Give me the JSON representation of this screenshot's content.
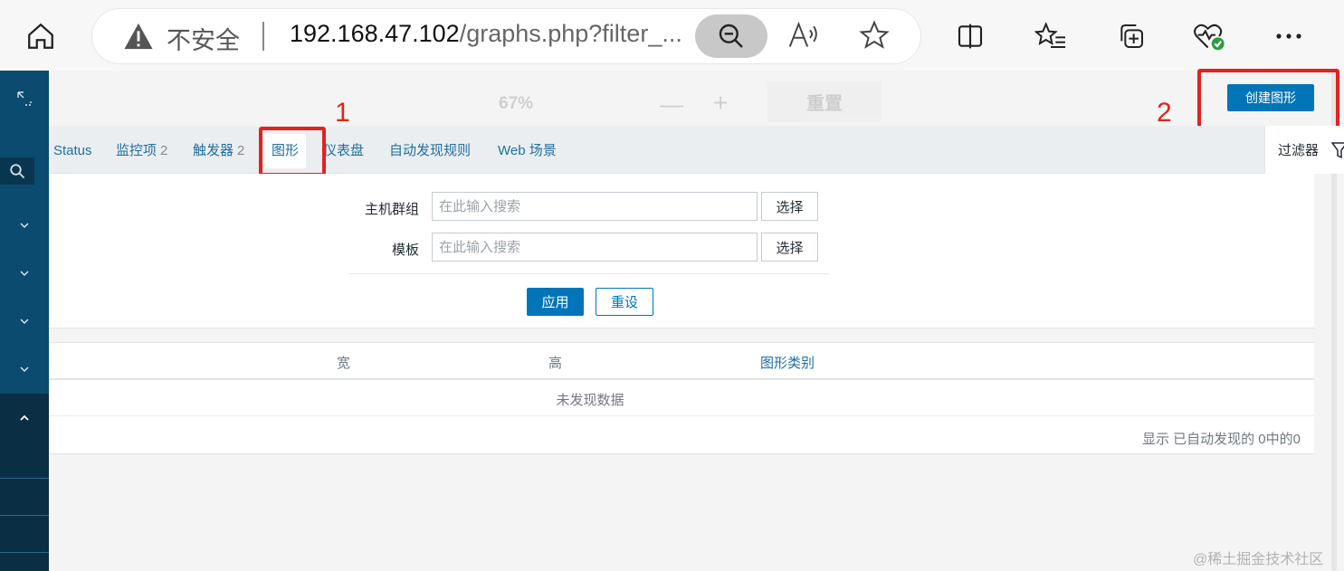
{
  "browser": {
    "security_label": "不安全",
    "url_host": "192.168.47.102",
    "url_rest": "/graphs.php?filter_..."
  },
  "zoom_popup": {
    "level": "67%",
    "minus": "—",
    "plus": "+",
    "reset_label": "重置"
  },
  "header": {
    "create_button": "创建图形"
  },
  "annotations": {
    "step1": "1",
    "step2": "2",
    "color": "#e0231f"
  },
  "tabs": [
    {
      "label": "Status",
      "count": ""
    },
    {
      "label": "监控项",
      "count": "2"
    },
    {
      "label": "触发器",
      "count": "2"
    },
    {
      "label": "图形",
      "count": ""
    },
    {
      "label": "仪表盘",
      "count": ""
    },
    {
      "label": "自动发现规则",
      "count": ""
    },
    {
      "label": "Web 场景",
      "count": ""
    }
  ],
  "filter": {
    "tab_label": "过滤器",
    "host_group_label": "主机群组",
    "template_label": "模板",
    "search_placeholder": "在此输入搜索",
    "select_label": "选择",
    "apply_label": "应用",
    "reset_label": "重设"
  },
  "table": {
    "columns": [
      "宽",
      "高",
      "图形类别"
    ],
    "empty_text": "未发现数据",
    "summary": "显示 已自动发现的 0中的0"
  },
  "watermark": "@稀土掘金技术社区",
  "colors": {
    "sidebar": "#0b4b6f",
    "primary": "#0275b8",
    "link": "#1f6ea0"
  }
}
